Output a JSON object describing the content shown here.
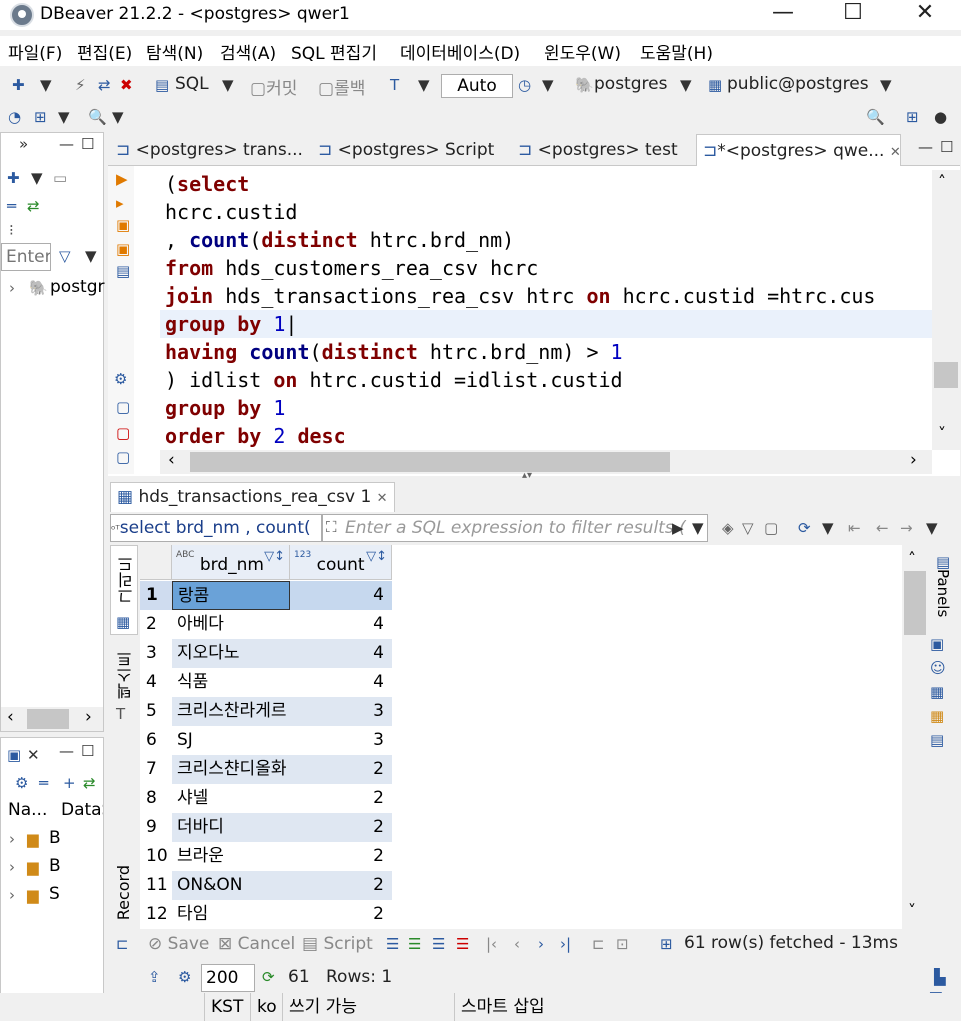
{
  "window": {
    "title": "DBeaver 21.2.2 - <postgres> qwer1"
  },
  "menu": [
    "파일(F)",
    "편집(E)",
    "탐색(N)",
    "검색(A)",
    "SQL 편집기",
    "데이터베이스(D)",
    "윈도우(W)",
    "도움말(H)"
  ],
  "toolbar": {
    "sql_label": "SQL",
    "commit_label": "커밋",
    "rollback_label": "롤백",
    "auto_label": "Auto",
    "datasource": "postgres",
    "schema": "public@postgres"
  },
  "left_nav": {
    "filter_placeholder": "Enter",
    "tree_item": "postgr",
    "project_cols": [
      "Na...",
      "DataS"
    ],
    "project_items": [
      "B",
      "B",
      "S"
    ]
  },
  "editor_tabs": [
    "<postgres> trans...",
    "<postgres> Script",
    "<postgres> test",
    "*<postgres> qwe..."
  ],
  "code_lines": [
    "(select",
    "hcrc.custid",
    ", count(distinct htrc.brd_nm)",
    "from hds_customers_rea_csv hcrc",
    "join hds_transactions_rea_csv htrc on hcrc.custid =htrc.cus",
    "group by 1",
    "having count(distinct htrc.brd_nm) > 1",
    ") idlist on htrc.custid =idlist.custid",
    "group by 1",
    "order by 2 desc"
  ],
  "results": {
    "tab_label": "hds_transactions_rea_csv 1",
    "query_preview": "select brd_nm , count(",
    "filter_placeholder": "Enter a SQL expression to filter results (",
    "columns": [
      {
        "type": "ABC",
        "name": "brd_nm"
      },
      {
        "type": "123",
        "name": "count"
      }
    ],
    "rows": [
      [
        "1",
        "랑콤",
        "4"
      ],
      [
        "2",
        "아베다",
        "4"
      ],
      [
        "3",
        "지오다노",
        "4"
      ],
      [
        "4",
        "식품",
        "4"
      ],
      [
        "5",
        "크리스찬라게르",
        "3"
      ],
      [
        "6",
        "SJ",
        "3"
      ],
      [
        "7",
        "크리스챤디올화",
        "2"
      ],
      [
        "8",
        "샤넬",
        "2"
      ],
      [
        "9",
        "더바디",
        "2"
      ],
      [
        "10",
        "브라운",
        "2"
      ],
      [
        "11",
        "ON&ON",
        "2"
      ],
      [
        "12",
        "타임",
        "2"
      ]
    ],
    "side_tabs": [
      "그리드",
      "텍스트",
      "Record"
    ],
    "panels_label": "Panels",
    "save_label": "Save",
    "cancel_label": "Cancel",
    "script_label": "Script",
    "fetch_status": "61 row(s) fetched - 13ms",
    "fetch_size": "200",
    "total_count": "61",
    "rows_label": "Rows: 1"
  },
  "statusline": [
    "KST",
    "ko",
    "쓰기 가능",
    "스마트 삽입"
  ]
}
